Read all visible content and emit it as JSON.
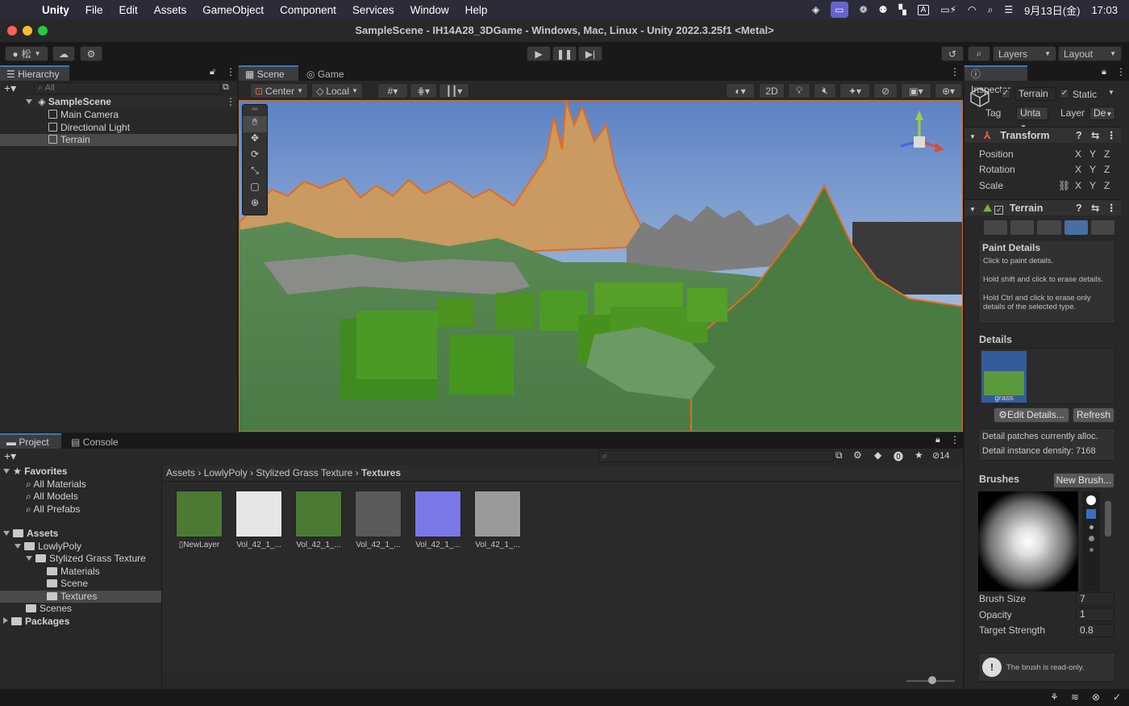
{
  "menubar": {
    "app": "Unity",
    "items": [
      "File",
      "Edit",
      "Assets",
      "GameObject",
      "Component",
      "Services",
      "Window",
      "Help"
    ],
    "ime": "A",
    "date": "9月13日(金)",
    "time": "17:03"
  },
  "window": {
    "title": "SampleScene - IH14A28_3DGame - Windows, Mac, Linux - Unity 2022.3.25f1 <Metal>"
  },
  "toolbar": {
    "account_label": "松",
    "layers_label": "Layers",
    "layout_label": "Layout"
  },
  "hierarchy": {
    "tab": "Hierarchy",
    "search_placeholder": "All",
    "scene": "SampleScene",
    "items": [
      "Main Camera",
      "Directional Light",
      "Terrain"
    ],
    "selected": "Terrain"
  },
  "scene_view": {
    "tabs": [
      "Scene",
      "Game"
    ],
    "pivot_label": "Center",
    "space_label": "Local",
    "mode_2d": "2D"
  },
  "inspector": {
    "tab": "Inspector",
    "object_name": "Terrain",
    "static_label": "Static",
    "tag_label": "Tag",
    "tag_value": "Unta",
    "layer_label": "Layer",
    "layer_value": "De",
    "transform": {
      "title": "Transform",
      "rows": [
        "Position",
        "Rotation",
        "Scale"
      ],
      "axes": [
        "X",
        "Y",
        "Z"
      ]
    },
    "terrain": {
      "title": "Terrain",
      "paint_title": "Paint Details",
      "paint_desc1": "Click to paint details.",
      "paint_desc2": "Hold shift and click to erase details.",
      "paint_desc3": "Hold Ctrl and click to erase only details of the selected type.",
      "details_label": "Details",
      "detail_item": "grass",
      "edit_details_btn": "Edit Details...",
      "refresh_btn": "Refresh",
      "patches_text": "Detail patches currently alloc.",
      "density_text": "Detail instance density: 7168",
      "brushes_label": "Brushes",
      "new_brush_btn": "New Brush...",
      "brush_size_label": "Brush Size",
      "brush_size_value": "7",
      "opacity_label": "Opacity",
      "opacity_value": "1",
      "target_strength_label": "Target Strength",
      "target_strength_value": "0.8",
      "readonly_note": "The brush is read-only."
    }
  },
  "project": {
    "tabs": [
      "Project",
      "Console"
    ],
    "hidden_count": "14",
    "favorites_label": "Favorites",
    "favorites": [
      "All Materials",
      "All Models",
      "All Prefabs"
    ],
    "assets_label": "Assets",
    "tree": {
      "lowlypoly": "LowlyPoly",
      "stylized": "Stylized Grass Texture",
      "children": [
        "Materials",
        "Scene",
        "Textures"
      ],
      "scenes": "Scenes",
      "packages": "Packages"
    },
    "breadcrumb": [
      "Assets",
      "LowlyPoly",
      "Stylized Grass Texture",
      "Textures"
    ],
    "files": [
      {
        "name": "NewLayer",
        "color": "#4c7a33"
      },
      {
        "name": "Vol_42_1_...",
        "color": "#e6e6e6"
      },
      {
        "name": "Vol_42_1_...",
        "color": "#4a7a34"
      },
      {
        "name": "Vol_42_1_...",
        "color": "#5a5a5a"
      },
      {
        "name": "Vol_42_1_...",
        "color": "#7a78e8"
      },
      {
        "name": "Vol_42_1_...",
        "color": "#9a9a9a"
      }
    ]
  }
}
